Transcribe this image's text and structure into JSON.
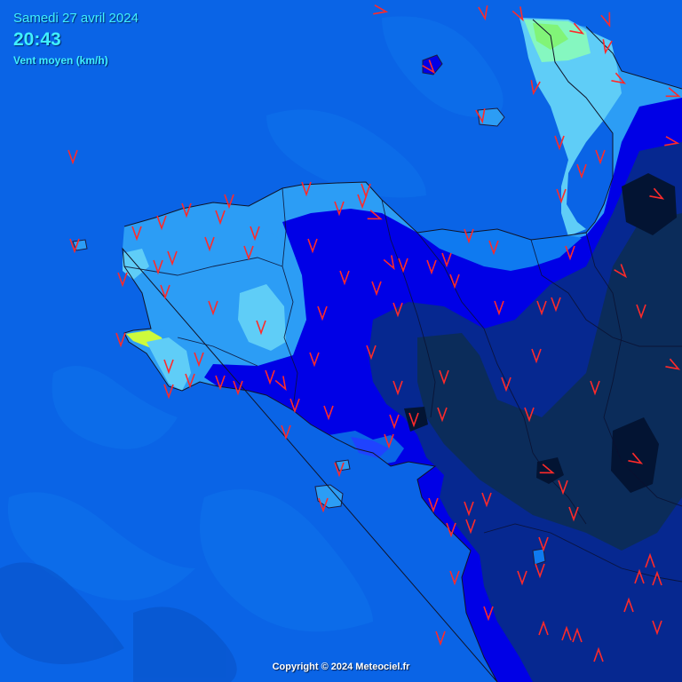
{
  "header": {
    "date": "Samedi 27 avril 2024",
    "time": "20:43",
    "metric": "Vent moyen (km/h)"
  },
  "footer": {
    "copyright": "Copyright © 2024 Meteociel.fr"
  },
  "colors": {
    "sea": "#0a64e6",
    "wind_very_light": "#0f7af0",
    "wind_light": "#2c9df5",
    "wind_moderate": "#5fcdf7",
    "wind_fresh": "#85f7c0",
    "wind_strong": "#cdfa3c",
    "wind_low_inland": "#0000e6",
    "wind_calm_inland": "#062890",
    "wind_calm": "#0b2c5a",
    "arrow": "#ff2a2a"
  },
  "icons": {
    "wind_arrow": "wind-direction-arrow-icon"
  }
}
